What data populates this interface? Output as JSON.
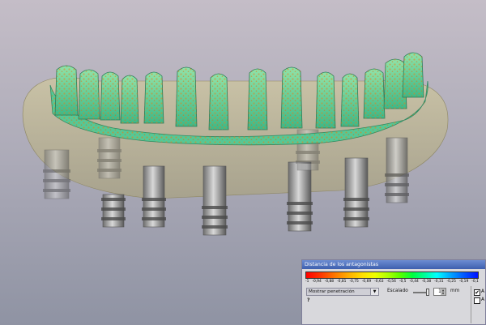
{
  "panel": {
    "title": "Distancia de los antagonistas",
    "scale_labels": [
      "-1",
      "-0,94",
      "-0,88",
      "-0,81",
      "-0,75",
      "-0,69",
      "-0,63",
      "-0,56",
      "-0,5",
      "-0,44",
      "-0,38",
      "-0,31",
      "-0,25",
      "-0,19",
      "-0,1"
    ],
    "mode_select": "Mostrar penetración",
    "scale_label": "Escalado",
    "scale_value": "1",
    "unit": "mm",
    "help": "?",
    "check_a_label": "A",
    "check_b_label": "A",
    "check_a_checked": true,
    "check_b_checked": false
  },
  "viewport": {
    "background_top": "#c4bdc7",
    "background_bottom": "#8f93a3",
    "crown_color": "#6fd49a",
    "contact_color": "#f07a10",
    "gingiva_color": "#bdb48c",
    "implant_color": "#8e8e8e"
  }
}
